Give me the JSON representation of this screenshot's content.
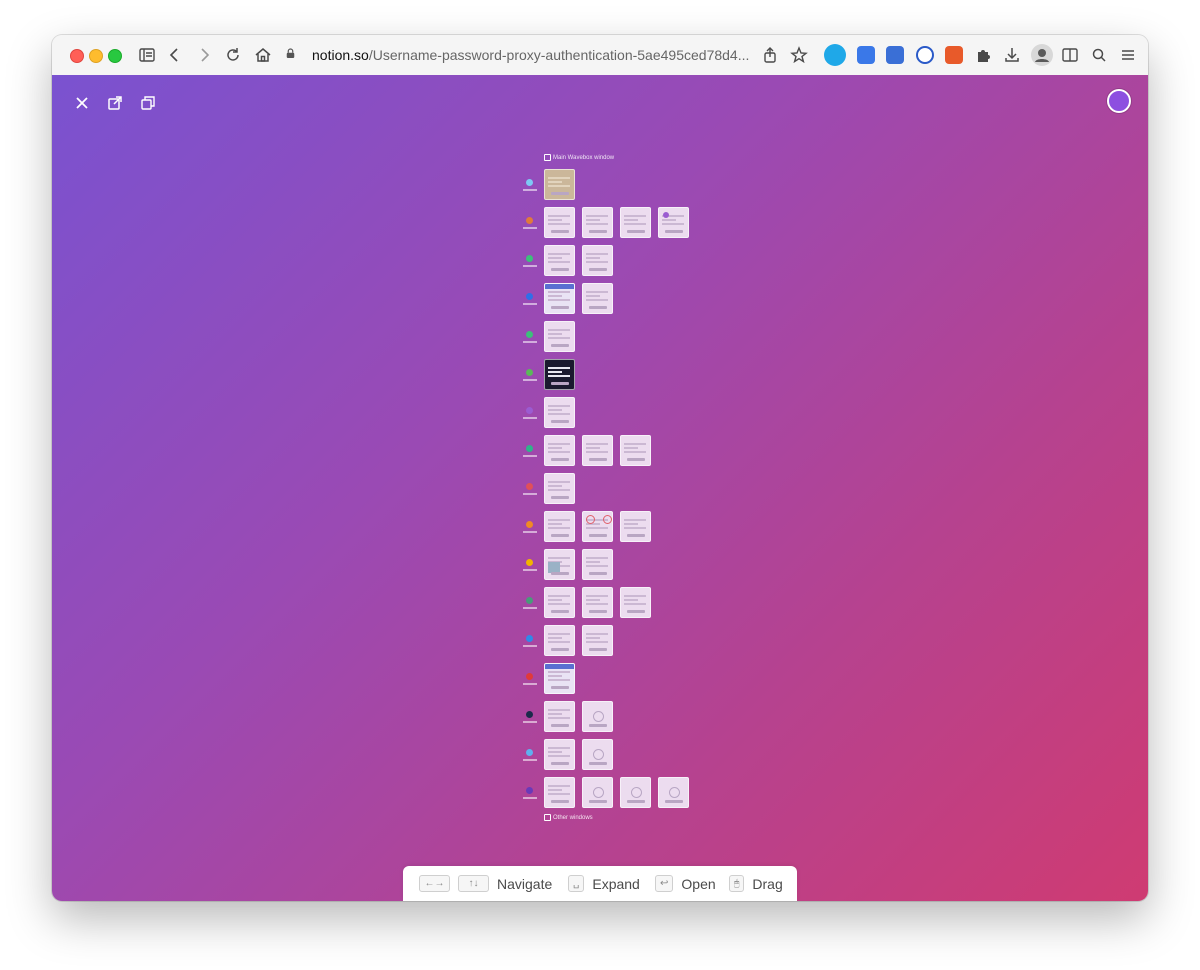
{
  "browser": {
    "url_host": "notion.so",
    "url_path": "/Username-password-proxy-authentication-5ae495ced78d4..."
  },
  "overview": {
    "main_window_label": "Main Wavebox window",
    "other_windows_label": "Other windows",
    "row_icon_colors": [
      "#7ec8f5",
      "#e07a3c",
      "#3cc07a",
      "#2f6fe8",
      "#3cc07a",
      "#5bb85a",
      "#9b5cd1",
      "#2fb38a",
      "#e0505a",
      "#f08a24",
      "#f2b400",
      "#4a9a7a",
      "#2f8ae8",
      "#e03a3a",
      "#1a2a4a",
      "#5fb0f0",
      "#6a3ab8"
    ],
    "rows": [
      [
        "photo"
      ],
      [
        "light",
        "light",
        "light",
        "avatar"
      ],
      [
        "light",
        "light"
      ],
      [
        "blue-top",
        "light"
      ],
      [
        "light"
      ],
      [
        "dark"
      ],
      [
        "light"
      ],
      [
        "light",
        "light",
        "light"
      ],
      [
        "light"
      ],
      [
        "light",
        "rings",
        "light"
      ],
      [
        "image",
        "light"
      ],
      [
        "light",
        "light",
        "light"
      ],
      [
        "light",
        "light"
      ],
      [
        "blue-top"
      ],
      [
        "light",
        "globe"
      ],
      [
        "light",
        "globe"
      ],
      [
        "light",
        "globe",
        "globe",
        "globe"
      ]
    ]
  },
  "hints": {
    "navigate_keys": [
      "←→",
      "↑↓"
    ],
    "navigate_label": "Navigate",
    "expand_key": "␣",
    "expand_label": "Expand",
    "open_key": "↩",
    "open_label": "Open",
    "drag_key": "🖱",
    "drag_label": "Drag"
  }
}
